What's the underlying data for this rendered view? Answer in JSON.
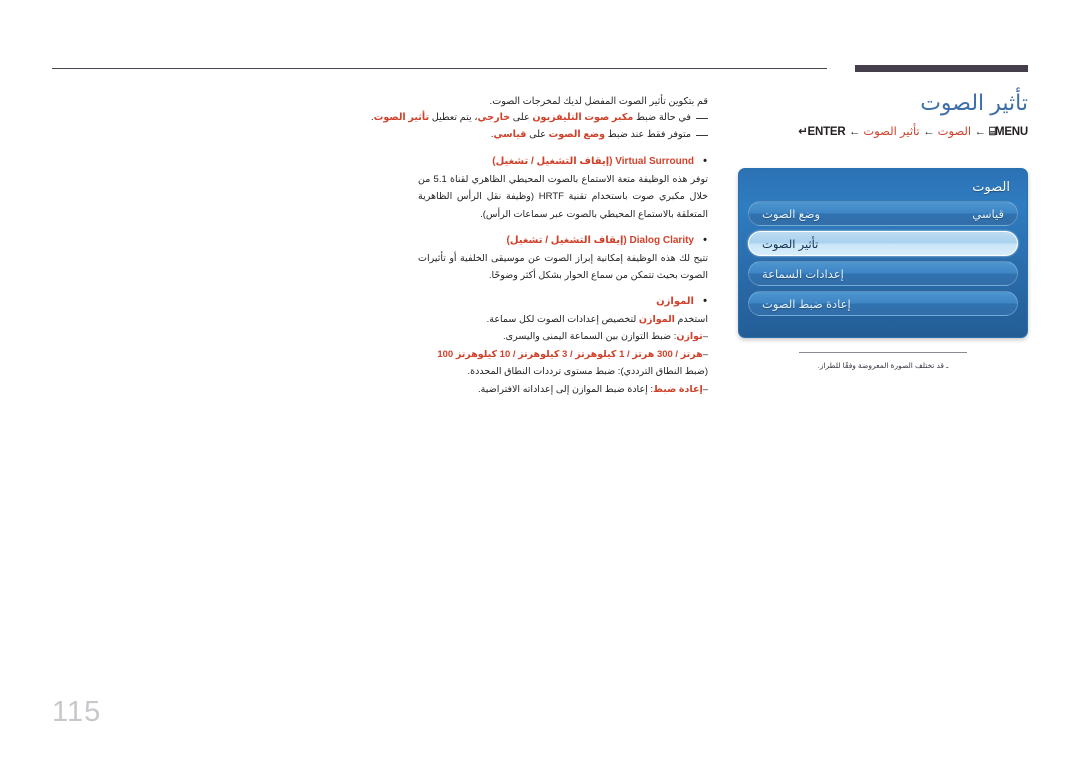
{
  "document": {
    "page_number": "115"
  },
  "header": {
    "title": "تأثير الصوت",
    "menu_path_prefix": "MENU",
    "menu_path_icon": "⌸",
    "menu_path_arrow": "←",
    "menu_path_item1": "الصوت",
    "menu_path_item2": "تأثير الصوت",
    "menu_path_enter": "ENTER",
    "menu_path_enter_icon": "↵"
  },
  "osd": {
    "panel_title": "الصوت",
    "rows": [
      {
        "label": "وضع الصوت",
        "value": "قياسي",
        "selected": false
      },
      {
        "label": "تأثير الصوت",
        "value": "",
        "selected": true
      },
      {
        "label": "إعدادات السماعة",
        "value": "",
        "selected": false
      },
      {
        "label": "إعادة ضبط الصوت",
        "value": "",
        "selected": false
      }
    ],
    "note": "ـ قد تختلف الصورة المعروضة وفقًا للطراز."
  },
  "content": {
    "intro": "قم بتكوين تأثير الصوت المفضل لديك لمخرجات الصوت.",
    "footnotes": [
      {
        "parts": [
          {
            "t": "في حالة ضبط ",
            "style": "plain"
          },
          {
            "t": "مكبر صوت التليفزيون",
            "style": "accent-b"
          },
          {
            "t": " على ",
            "style": "plain"
          },
          {
            "t": "خارجي",
            "style": "accent-b"
          },
          {
            "t": "، يتم تعطيل ",
            "style": "plain"
          },
          {
            "t": "تأثير الصوت",
            "style": "accent-b"
          },
          {
            "t": ".",
            "style": "plain"
          }
        ]
      },
      {
        "parts": [
          {
            "t": "متوفر فقط عند ضبط ",
            "style": "plain"
          },
          {
            "t": "وضع الصوت",
            "style": "accent-b"
          },
          {
            "t": " على ",
            "style": "plain"
          },
          {
            "t": "قياسي",
            "style": "accent-b"
          },
          {
            "t": ".",
            "style": "plain"
          }
        ]
      }
    ],
    "bullets": [
      {
        "name_en": "Virtual Surround",
        "options": "(إيقاف التشغيل / تشغيل)",
        "body": "توفر هذه الوظيفة متعة الاستماع بالصوت المحيطي الظاهري لقناة 5.1 من خلال مكبري صوت باستخدام تقنية HRTF (وظيفة نقل الرأس الظاهرية المتعلقة بالاستماع المحيطي بالصوت عبر سماعات الرأس)."
      },
      {
        "name_en": "Dialog Clarity",
        "options": "(إيقاف التشغيل / تشغيل)",
        "body": "تتيح لك هذه الوظيفة إمكانية إبراز الصوت عن موسيقى الخلفية أو تأثيرات الصوت بحيث تتمكن من سماع الحوار بشكل أكثر وضوحًا."
      },
      {
        "name_ar": "الموازن",
        "body": "استخدم الموازن لتخصيص إعدادات الصوت لكل سماعة.",
        "sub_items": [
          {
            "lead": "توازن",
            "rest": ": ضبط التوازن بين السماعة اليمنى واليسرى."
          },
          {
            "lead_ltr": "100 هرتز / 300 هرتز / 1 كيلوهرتز / 3 كيلوهرتز / 10 كيلوهرتز",
            "rest": " (ضبط النطاق الترددي): ضبط مستوى ترددات النطاق المحددة."
          },
          {
            "lead": "إعادة ضبط",
            "rest": ": إعادة ضبط الموازن إلى إعداداته الافتراضية."
          }
        ]
      }
    ]
  }
}
